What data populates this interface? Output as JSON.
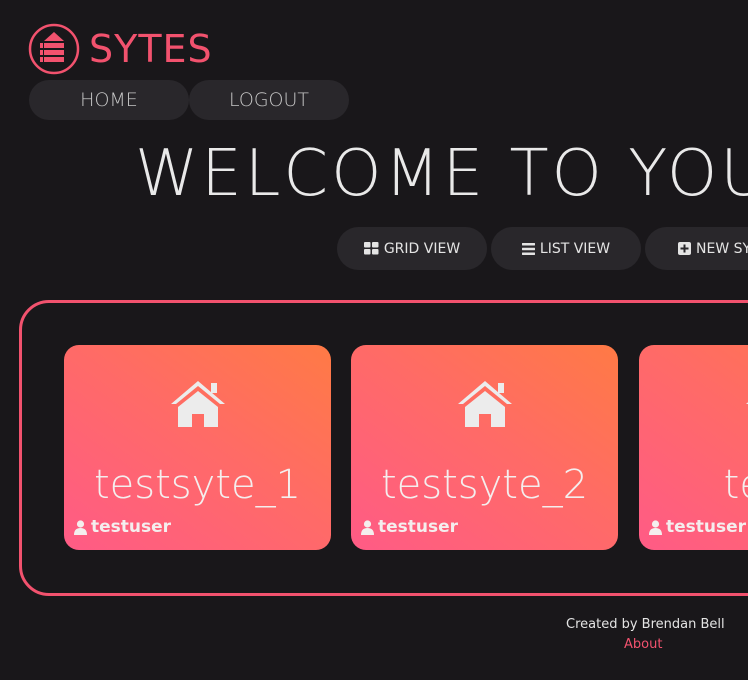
{
  "brand": {
    "name": "SYTES",
    "accent_color": "#f2526e",
    "logo_icon": "stacked-layers-arrow-icon"
  },
  "nav": {
    "home_label": "HOME",
    "logout_label": "LOGOUT"
  },
  "page": {
    "heading": "WELCOME TO YOUR"
  },
  "toolbar": {
    "grid_label": "GRID VIEW",
    "grid_icon": "grid-icon",
    "list_label": "LIST VIEW",
    "list_icon": "list-icon",
    "new_label": "NEW SY",
    "new_icon": "plus-square-icon"
  },
  "sytes": [
    {
      "title": "testsyte_1",
      "owner": "testuser",
      "icon": "home-icon"
    },
    {
      "title": "testsyte_2",
      "owner": "testuser",
      "icon": "home-icon"
    },
    {
      "title": "tests",
      "owner": "testuser",
      "icon": "home-icon"
    }
  ],
  "footer": {
    "credit": "Created by Brendan Bell",
    "about_label": "About"
  },
  "colors": {
    "background": "#19171a",
    "button_bg": "#29272b",
    "card_gradient_start": "#ff5b86",
    "card_gradient_end": "#ff7a45"
  }
}
